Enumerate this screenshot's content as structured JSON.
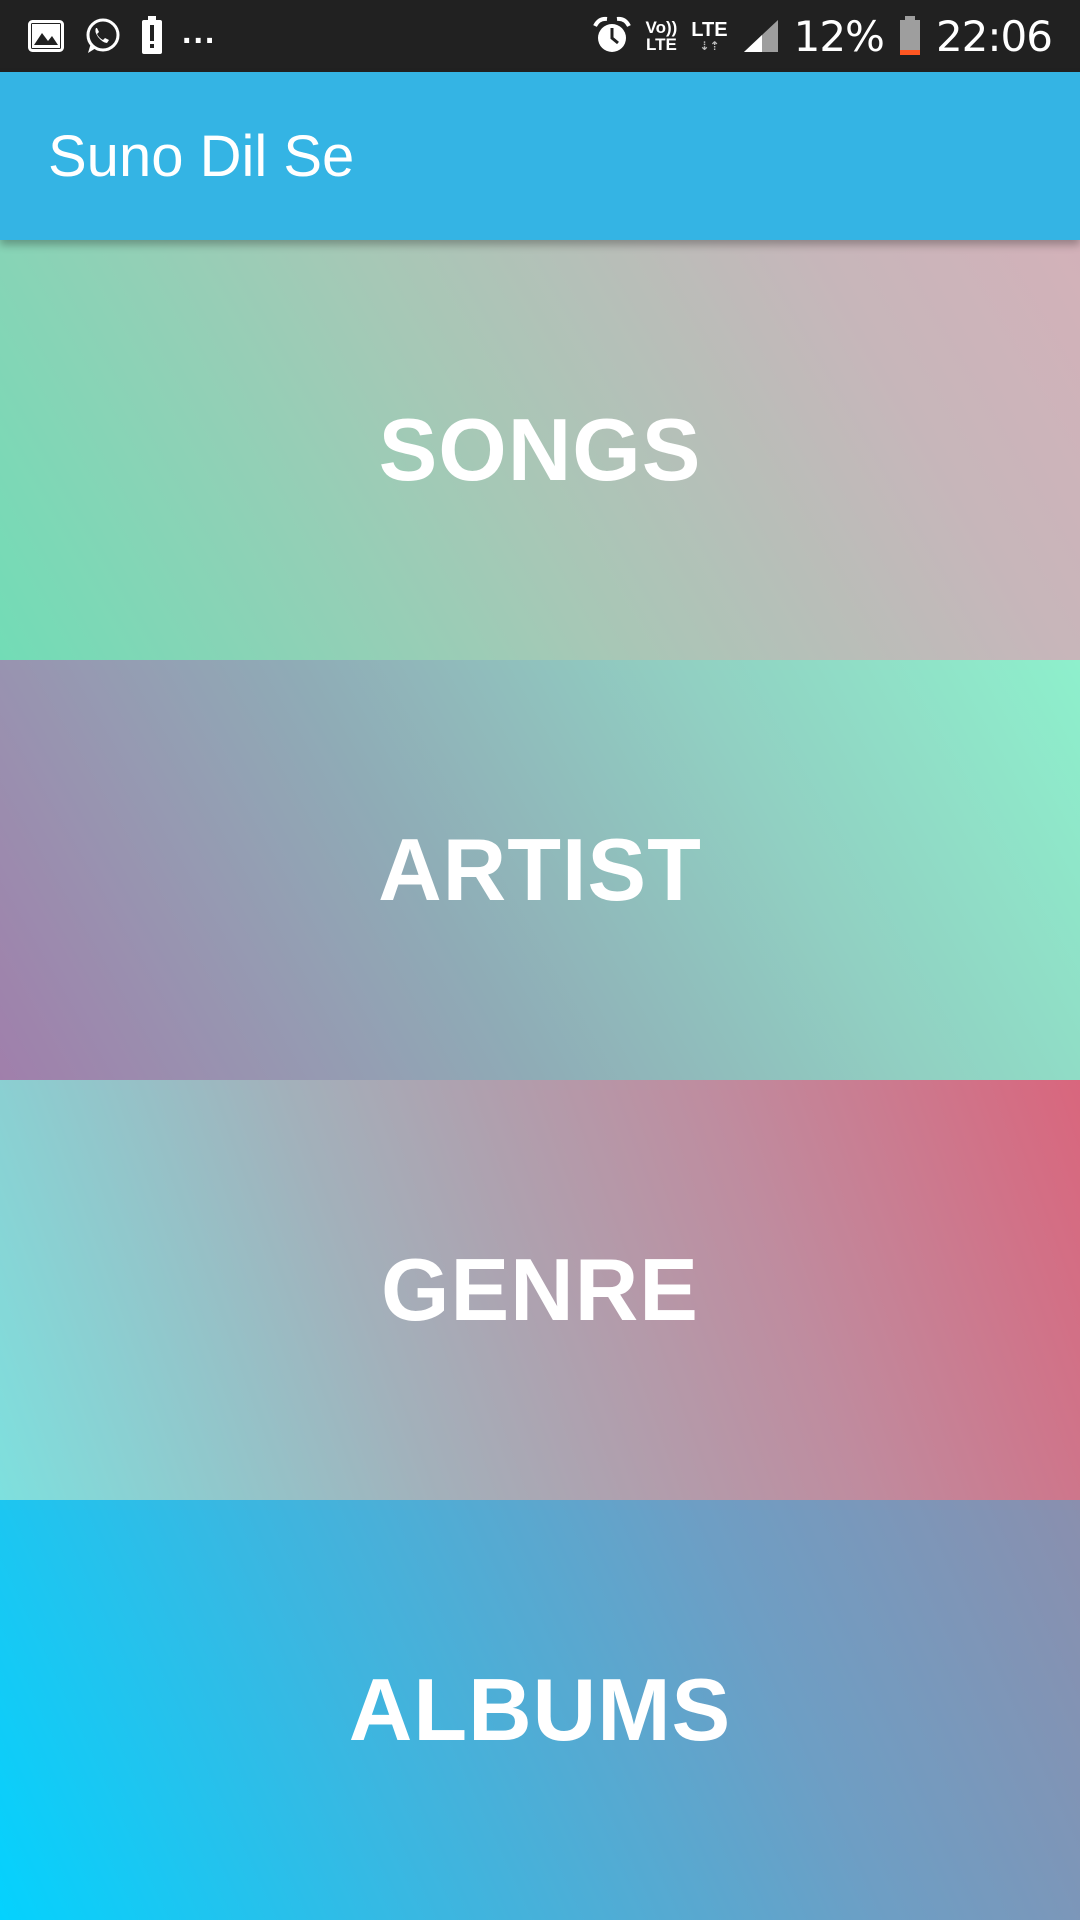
{
  "status_bar": {
    "left_icons": [
      "gallery-icon",
      "whatsapp-icon",
      "battery-alert-icon"
    ],
    "overflow": "...",
    "alarm_icon": "alarm-icon",
    "volte_top": "Vo))",
    "volte_bottom": "LTE",
    "network_type": "LTE",
    "network_arrows": "⇣⇡",
    "signal_icon": "signal-icon",
    "battery_percent": "12%",
    "battery_icon": "battery-low-icon",
    "time": "22:06"
  },
  "app_bar": {
    "title": "Suno Dil Se",
    "color": "#34b4e4"
  },
  "menu": {
    "items": [
      {
        "label": "SONGS"
      },
      {
        "label": "ARTIST"
      },
      {
        "label": "GENRE"
      },
      {
        "label": "ALBUMS"
      }
    ]
  }
}
